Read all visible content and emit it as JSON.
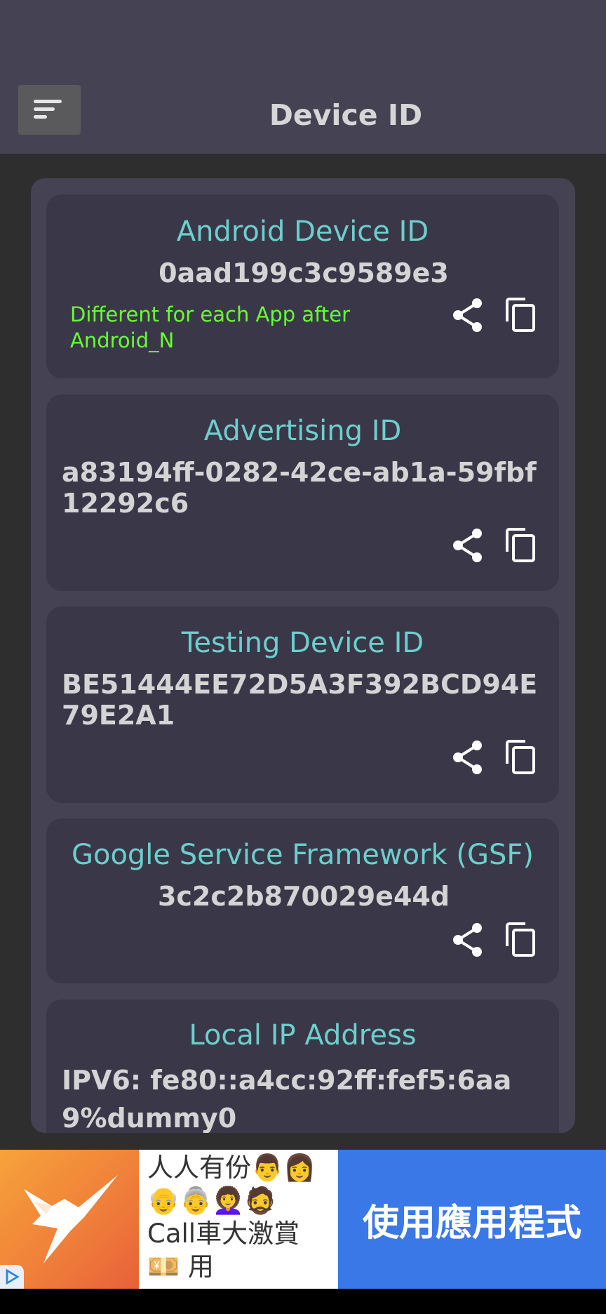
{
  "header": {
    "title": "Device ID",
    "menu_icon": "sort-menu-icon"
  },
  "cards": [
    {
      "title": "Android Device ID",
      "value": "0aad199c3c9589e3",
      "note": "Different for each App after Android_N",
      "actions": {
        "share_icon": "share-icon",
        "copy_icon": "copy-icon"
      }
    },
    {
      "title": "Advertising ID",
      "value": "a83194ff-0282-42ce-ab1a-59fbf12292c6",
      "actions": {
        "share_icon": "share-icon",
        "copy_icon": "copy-icon"
      }
    },
    {
      "title": "Testing Device ID",
      "value": "BE51444EE72D5A3F392BCD94E79E2A1",
      "actions": {
        "share_icon": "share-icon",
        "copy_icon": "copy-icon"
      }
    },
    {
      "title": "Google Service Framework (GSF)",
      "value": "3c2c2b870029e44d",
      "actions": {
        "share_icon": "share-icon",
        "copy_icon": "copy-icon"
      }
    },
    {
      "title": "Local IP Address",
      "value": "IPV6:  fe80::a4cc:92ff:fef5:6aa9%dummy0"
    }
  ],
  "ad": {
    "text": "人人有份👨👩👴👵👩‍🦱🧔 Call車大激賞 💴 用",
    "cta": "使用應用程式",
    "badge_icon": "ad-choices-icon",
    "logo_icon": "hummingbird-logo-icon"
  },
  "colors": {
    "header_bg": "#454353",
    "card_bg": "#3a3848",
    "title_teal": "#6ccfce",
    "note_green": "#66ff33",
    "cta_blue": "#3b78e7"
  }
}
